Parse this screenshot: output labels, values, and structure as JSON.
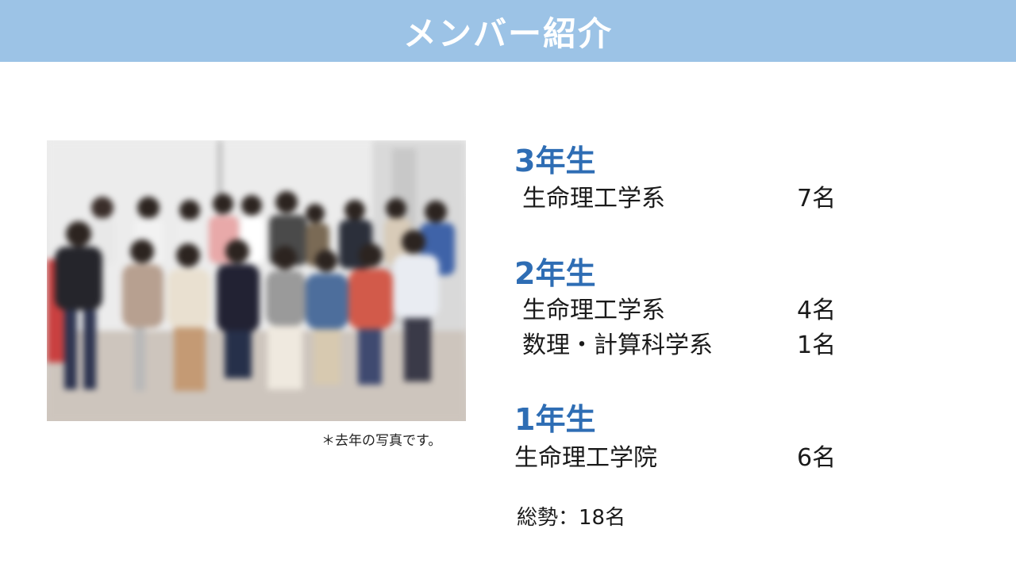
{
  "header": {
    "title": "メンバー紹介"
  },
  "photo": {
    "caption": "＊去年の写真です。"
  },
  "years": [
    {
      "heading": "3年生",
      "rows": [
        {
          "dept": "生命理工学系",
          "count": "7名"
        }
      ]
    },
    {
      "heading": "2年生",
      "rows": [
        {
          "dept": "生命理工学系",
          "count": "4名"
        },
        {
          "dept": "数理・計算科学系",
          "count": "1名"
        }
      ]
    },
    {
      "heading": "1年生",
      "rows": [
        {
          "dept": "生命理工学院",
          "count": "6名"
        }
      ]
    }
  ],
  "summary": {
    "total": "総勢：18名"
  },
  "colors": {
    "header_bg": "#9cc3e6",
    "heading": "#2e6db4"
  }
}
